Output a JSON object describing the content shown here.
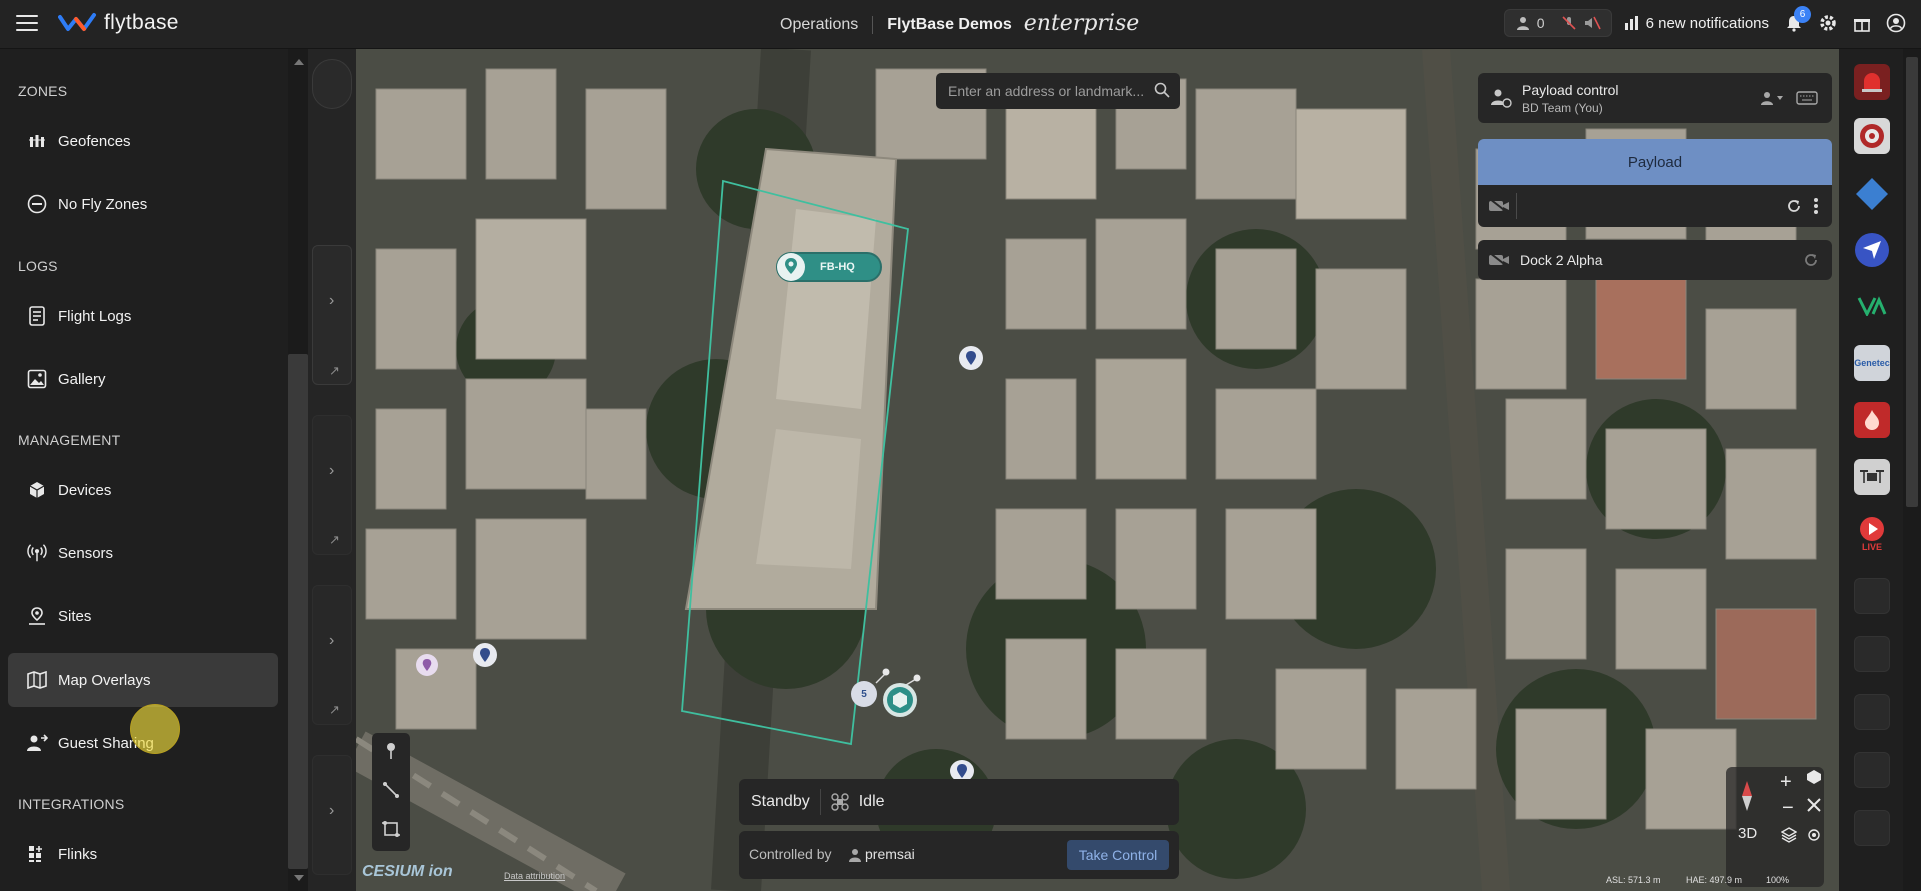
{
  "header": {
    "logo_text": "flytbase",
    "operations_label": "Operations",
    "org_label": "FlytBase Demos",
    "edition_label": "enterprise",
    "user_count": "0",
    "notifications_label": "6 new notifications",
    "notification_badge": "6"
  },
  "sidebar": {
    "sections": [
      {
        "title": "ZONES",
        "items": [
          "Geofences",
          "No Fly Zones"
        ]
      },
      {
        "title": "LOGS",
        "items": [
          "Flight Logs",
          "Gallery"
        ]
      },
      {
        "title": "MANAGEMENT",
        "items": [
          "Devices",
          "Sensors",
          "Sites",
          "Map Overlays",
          "Guest Sharing"
        ]
      },
      {
        "title": "INTEGRATIONS",
        "items": [
          "Flinks"
        ]
      }
    ],
    "active_item": "Map Overlays"
  },
  "map": {
    "search_placeholder": "Enter an address or landmark...",
    "site_marker_label": "FB-HQ",
    "dock_badge_number": "5",
    "view_mode": "3D",
    "attribution": "Data attribution",
    "cesium_label": "CESIUM ion",
    "asl_label": "ASL: 571.3 m",
    "hae_label": "HAE: 497.9 m",
    "zoom_label": "100%"
  },
  "payload_panel": {
    "control_title": "Payload control",
    "control_subtitle": "BD Team (You)",
    "payload_header": "Payload",
    "dock_name": "Dock 2 Alpha"
  },
  "status_panel": {
    "state": "Standby",
    "activity": "Idle",
    "controlled_by_label": "Controlled by",
    "controller": "premsai",
    "take_control_label": "Take Control"
  },
  "rail": {
    "icons": [
      "alarm-icon",
      "shield-badge-icon",
      "diamond-icon",
      "navigation-icon",
      "vertical-ai-icon",
      "genetec-icon",
      "fire-icon",
      "drone-icon",
      "live-icon",
      "placeholder-icon",
      "placeholder-icon",
      "placeholder-icon",
      "placeholder-icon",
      "placeholder-icon"
    ],
    "genetec_label": "Genetec",
    "live_label": "LIVE"
  },
  "colors": {
    "accent_blue": "#6e8fc4",
    "take_control_bg": "#344a6c",
    "geofence_green": "#3fbf9f",
    "active_item_bg": "#3a3a3a"
  }
}
